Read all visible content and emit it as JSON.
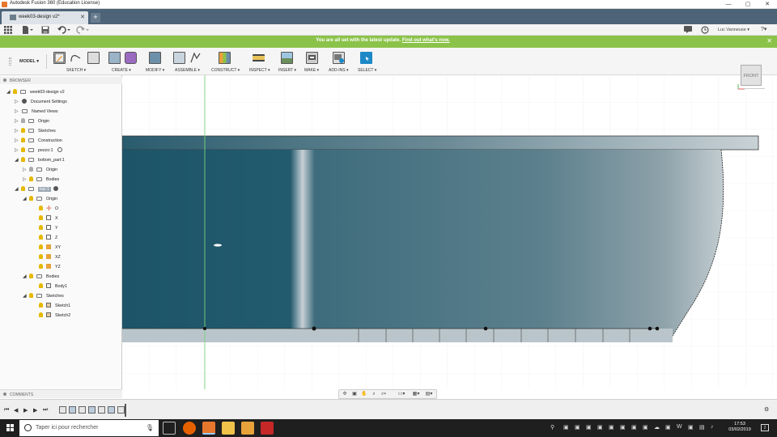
{
  "window": {
    "title": "Autodesk Fusion 360 (Education License)",
    "min": "—",
    "max": "▢",
    "close": "✕"
  },
  "tab": {
    "label": "week03-design v2*",
    "close": "✕",
    "new_tab": "+"
  },
  "banner": {
    "text": "You are all set with the latest update.",
    "link": "Find out what's now.",
    "close": "✕"
  },
  "quick_access": {
    "user": "Luc Vanneuse ▾",
    "help": "?▾"
  },
  "toolbar": {
    "workspace": "MODEL ▾",
    "groups": [
      {
        "label": "SKETCH ▾"
      },
      {
        "label": "CREATE ▾"
      },
      {
        "label": "MODIFY ▾"
      },
      {
        "label": "ASSEMBLE ▾"
      },
      {
        "label": "CONSTRUCT ▾"
      },
      {
        "label": "INSPECT ▾"
      },
      {
        "label": "INSERT ▾"
      },
      {
        "label": "MAKE ▾"
      },
      {
        "label": "ADD-INS ▾"
      },
      {
        "label": "SELECT ▾"
      }
    ]
  },
  "browser": {
    "title": "BROWSER",
    "nodes": [
      {
        "label": "week03-design v2"
      },
      {
        "label": "Document Settings"
      },
      {
        "label": "Named Views"
      },
      {
        "label": "Origin"
      },
      {
        "label": "Sketches"
      },
      {
        "label": "Construction"
      },
      {
        "label": "pezzo:1"
      },
      {
        "label": "bottom_part:1"
      },
      {
        "label": "Origin"
      },
      {
        "label": "Bodies"
      },
      {
        "label": "top:1"
      },
      {
        "label": "Origin"
      },
      {
        "label": "O"
      },
      {
        "label": "X"
      },
      {
        "label": "Y"
      },
      {
        "label": "Z"
      },
      {
        "label": "XY"
      },
      {
        "label": "XZ"
      },
      {
        "label": "YZ"
      },
      {
        "label": "Bodies"
      },
      {
        "label": "Body1"
      },
      {
        "label": "Sketches"
      },
      {
        "label": "Sketch1"
      },
      {
        "label": "Sketch2"
      }
    ]
  },
  "viewcube": {
    "face": "FRONT"
  },
  "comments": {
    "title": "COMMENTS"
  },
  "taskbar": {
    "search_placeholder": "Taper ici pour rechercher",
    "time": "17:53",
    "date": "03/02/2019"
  },
  "colors": {
    "banner": "#8bc34a",
    "tabbar": "#4d6378",
    "model": "#2e5f72",
    "select": "#1e88c7"
  }
}
